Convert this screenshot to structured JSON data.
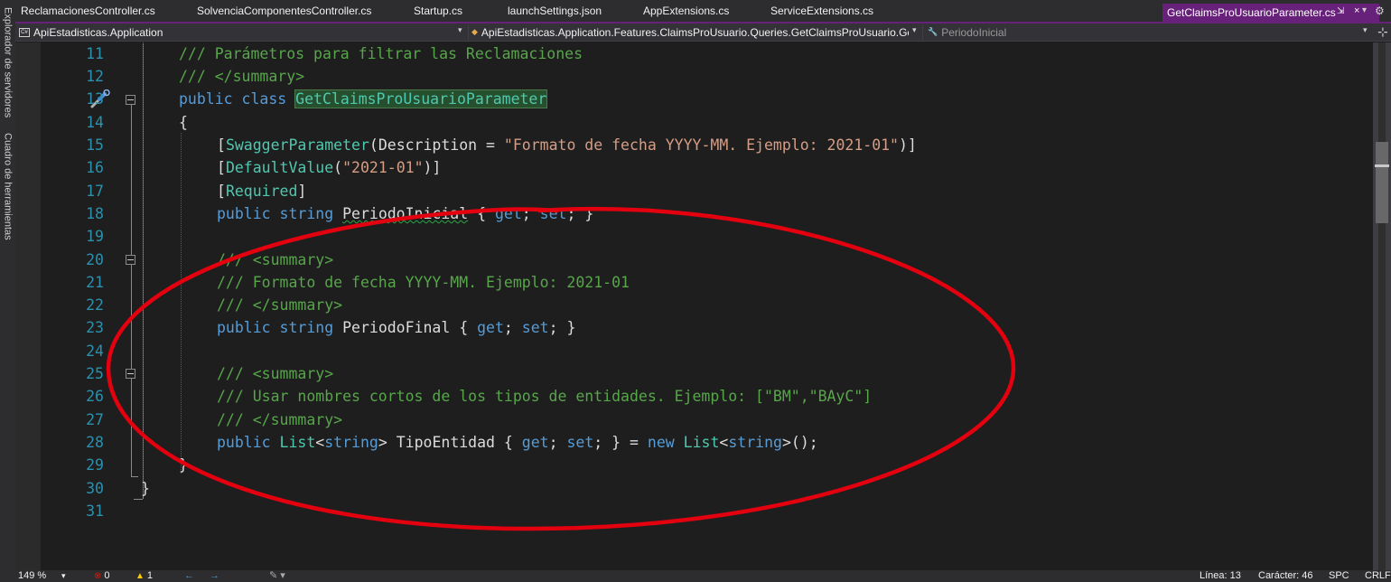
{
  "side_tabs": [
    "Explorador de servidores",
    "Cuadro de herramientas"
  ],
  "tabs": [
    {
      "label": "ReclamacionesController.cs"
    },
    {
      "label": "SolvenciaComponentesController.cs"
    },
    {
      "label": "Startup.cs"
    },
    {
      "label": "launchSettings.json"
    },
    {
      "label": "AppExtensions.cs"
    },
    {
      "label": "ServiceExtensions.cs"
    }
  ],
  "active_tab": {
    "label": "GetClaimsProUsuarioParameter.cs",
    "pin": "⇲",
    "close": "×"
  },
  "nav": {
    "project": "ApiEstadisticas.Application",
    "type_path": "ApiEstadisticas.Application.Features.ClaimsProUsuario.Queries.GetClaimsProUsuario.Get",
    "member": "PeriodoInicial"
  },
  "code_lines": [
    {
      "n": "11"
    },
    {
      "n": "12"
    },
    {
      "n": "13"
    },
    {
      "n": "14"
    },
    {
      "n": "15"
    },
    {
      "n": "16"
    },
    {
      "n": "17"
    },
    {
      "n": "18"
    },
    {
      "n": "19"
    },
    {
      "n": "20"
    },
    {
      "n": "21"
    },
    {
      "n": "22"
    },
    {
      "n": "23"
    },
    {
      "n": "24"
    },
    {
      "n": "25"
    },
    {
      "n": "26"
    },
    {
      "n": "27"
    },
    {
      "n": "28"
    },
    {
      "n": "29"
    },
    {
      "n": "30"
    },
    {
      "n": "31"
    }
  ],
  "code": {
    "l11": "/// Parámetros para filtrar las Reclamaciones",
    "l12": "/// </summary>",
    "l13_kw": "public class",
    "l13_cls": "GetClaimsProUsuarioParameter",
    "l14": "{",
    "l15_open": "[",
    "l15_attr": "SwaggerParameter",
    "l15_mid": "(Description = ",
    "l15_str": "\"Formato de fecha YYYY-MM. Ejemplo: 2021-01\"",
    "l15_close": ")]",
    "l16_open": "[",
    "l16_attr": "DefaultValue",
    "l16_p1": "(",
    "l16_str": "\"2021-01\"",
    "l16_close": ")]",
    "l17_open": "[",
    "l17_attr": "Required",
    "l17_close": "]",
    "l18_kw": "public string",
    "l18_name": "PeriodoInicial",
    "l18_b1": "{",
    "l18_get": "get",
    "l18_semi1": ";",
    "l18_set": "set",
    "l18_semi2": "; }",
    "l20": "/// <summary>",
    "l21": "/// Formato de fecha YYYY-MM. Ejemplo: 2021-01",
    "l22": "/// </summary>",
    "l23_kw": "public string",
    "l23_name": "PeriodoFinal",
    "l23_b1": "{",
    "l23_get": "get",
    "l23_semi1": ";",
    "l23_set": "set",
    "l23_semi2": "; }",
    "l25": "/// <summary>",
    "l26": "/// Usar nombres cortos de los tipos de entidades. Ejemplo: [\"BM\",\"BAyC\"]",
    "l27": "/// </summary>",
    "l28_kw": "public",
    "l28_type": "List",
    "l28_lt": "<",
    "l28_str": "string",
    "l28_gt": "> TipoEntidad {",
    "l28_get": "get",
    "l28_semi1": ";",
    "l28_set": "set",
    "l28_eq": "; } =",
    "l28_new": "new",
    "l28_type2": "List",
    "l28_lt2": "<",
    "l28_str2": "string",
    "l28_end": ">();",
    "l29": "}",
    "l30": "}"
  },
  "status": {
    "zoom": "149 %",
    "zoom_caret": "▾",
    "errors": "0",
    "warnings": "1",
    "line": "Línea: 13",
    "char": "Carácter: 46",
    "spc": "SPC",
    "eol": "CRLF"
  },
  "colors": {
    "annotation": "#e3000f",
    "active_tab": "#68217a"
  }
}
